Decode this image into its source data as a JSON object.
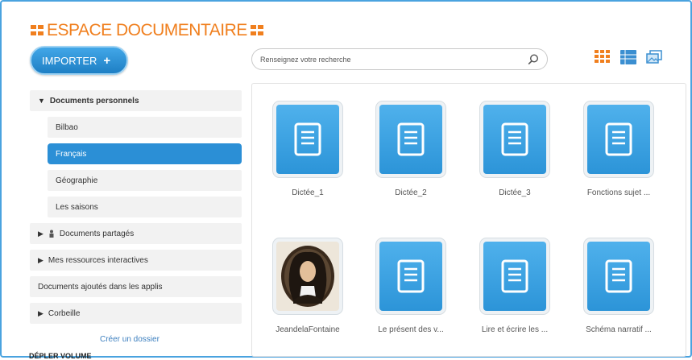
{
  "header": {
    "title": "ESPACE DOCUMENTAIRE"
  },
  "toolbar": {
    "import_label": "IMPORTER",
    "import_plus": "+"
  },
  "search": {
    "placeholder": "Renseignez votre recherche"
  },
  "view_modes": [
    "grid-view-icon",
    "list-view-icon",
    "slideshow-view-icon"
  ],
  "sidebar": {
    "items": [
      {
        "label": "Documents personnels",
        "arrow": "▼"
      },
      {
        "label": "Bilbao"
      },
      {
        "label": "Français"
      },
      {
        "label": "Géographie"
      },
      {
        "label": "Les saisons"
      },
      {
        "label": "Documents partagés",
        "arrow": "▶"
      },
      {
        "label": "Mes ressources interactives",
        "arrow": "▶"
      },
      {
        "label": "Documents ajoutés dans les applis"
      },
      {
        "label": "Corbeille",
        "arrow": "▶"
      }
    ],
    "create_folder": "Créer un dossier",
    "bottom_text": "DÉPLER VOLUME"
  },
  "files": [
    {
      "name": "Dictée_1",
      "type": "document"
    },
    {
      "name": "Dictée_2",
      "type": "document"
    },
    {
      "name": "Dictée_3",
      "type": "document"
    },
    {
      "name": "Fonctions sujet ...",
      "type": "document"
    },
    {
      "name": "JeandelaFontaine",
      "type": "image"
    },
    {
      "name": "Le présent des v...",
      "type": "document"
    },
    {
      "name": "Lire et écrire les ...",
      "type": "document"
    },
    {
      "name": "Schéma narratif ...",
      "type": "document"
    }
  ],
  "colors": {
    "accent": "#f07f1e",
    "primary": "#2b8fd6",
    "tile": "#3ea4e6"
  }
}
